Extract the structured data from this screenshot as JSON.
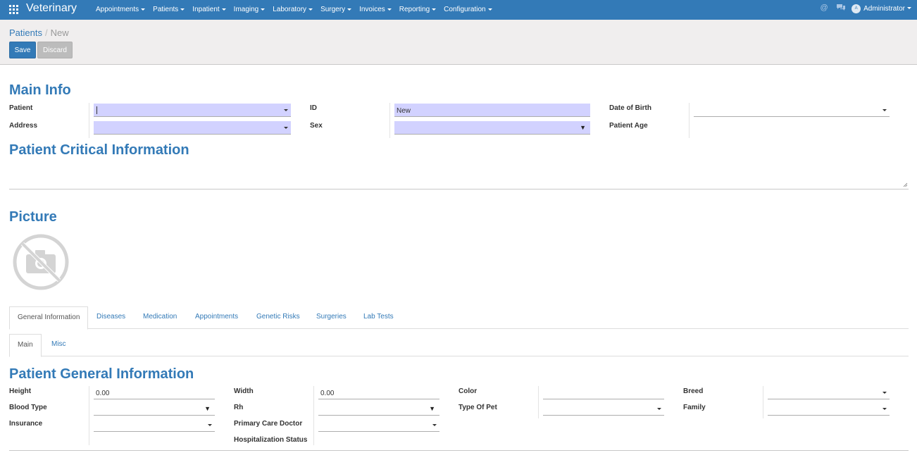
{
  "navbar": {
    "brand": "Veterinary",
    "menus": [
      {
        "label": "Appointments"
      },
      {
        "label": "Patients"
      },
      {
        "label": "Inpatient"
      },
      {
        "label": "Imaging"
      },
      {
        "label": "Laboratory"
      },
      {
        "label": "Surgery"
      },
      {
        "label": "Invoices"
      },
      {
        "label": "Reporting"
      },
      {
        "label": "Configuration"
      }
    ],
    "user": "Administrator",
    "accent": "#337ab7"
  },
  "breadcrumb": {
    "parent": "Patients",
    "current": "New"
  },
  "buttons": {
    "save": "Save",
    "discard": "Discard"
  },
  "main_info": {
    "title": "Main Info",
    "patient_label": "Patient",
    "patient_value": "",
    "address_label": "Address",
    "address_value": "",
    "id_label": "ID",
    "id_value": "New",
    "sex_label": "Sex",
    "sex_value": "",
    "dob_label": "Date of Birth",
    "dob_value": "",
    "age_label": "Patient Age"
  },
  "critical": {
    "title": "Patient Critical Information",
    "value": ""
  },
  "picture": {
    "title": "Picture",
    "placeholder_icon": "no-camera-icon"
  },
  "tabs": [
    {
      "label": "General Information"
    },
    {
      "label": "Diseases"
    },
    {
      "label": "Medication"
    },
    {
      "label": "Appointments"
    },
    {
      "label": "Genetic Risks"
    },
    {
      "label": "Surgeries"
    },
    {
      "label": "Lab Tests"
    }
  ],
  "subtabs": [
    {
      "label": "Main"
    },
    {
      "label": "Misc"
    }
  ],
  "general": {
    "title": "Patient General Information",
    "height_label": "Height",
    "height_value": "0.00",
    "blood_type_label": "Blood Type",
    "insurance_label": "Insurance",
    "width_label": "Width",
    "width_value": "0.00",
    "rh_label": "Rh",
    "pcd_label": "Primary Care Doctor",
    "hosp_label": "Hospitalization Status",
    "color_label": "Color",
    "type_label": "Type Of Pet",
    "breed_label": "Breed",
    "family_label": "Family"
  },
  "colors": {
    "required_field": "#d2d2ff",
    "heading": "#337ab7"
  }
}
